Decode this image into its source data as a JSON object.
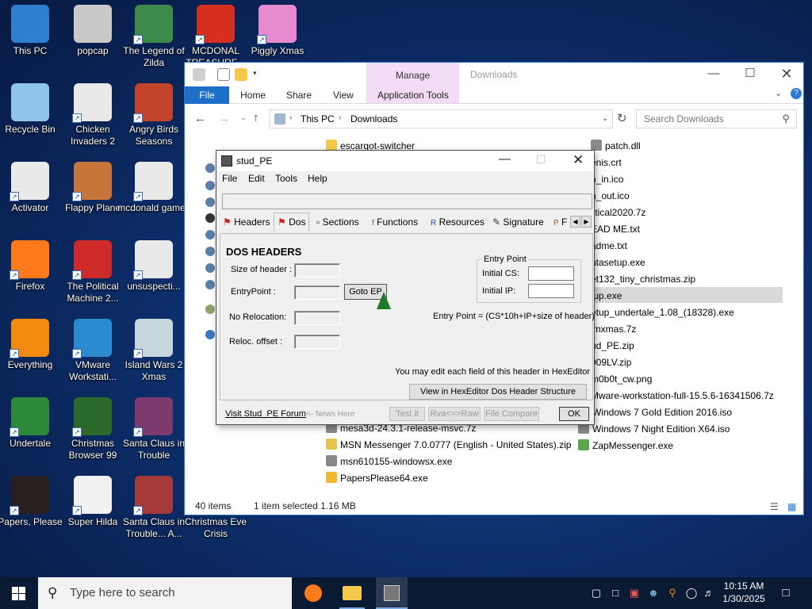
{
  "desktop": {
    "icons": [
      {
        "label": "This PC",
        "icon": "computer-icon",
        "color": "#2f7fd1"
      },
      {
        "label": "popcap",
        "icon": "popcap-icon",
        "color": "#c9c9c9"
      },
      {
        "label": "The Legend of Zilda",
        "icon": "game-icon",
        "color": "#3d8a4a"
      },
      {
        "label": "MCDONAL TREASURE...",
        "icon": "mcdonalds-icon",
        "color": "#d62f1f"
      },
      {
        "label": "Piggly Xmas",
        "icon": "pig-icon",
        "color": "#e78bd0"
      },
      {
        "label": "Recycle Bin",
        "icon": "recycle-bin-icon",
        "color": "#8fc6e8"
      },
      {
        "label": "Chicken Invaders 2",
        "icon": "chicken-icon",
        "color": "#e9e9e9"
      },
      {
        "label": "Angry Birds Seasons",
        "icon": "angry-birds-icon",
        "color": "#c4432b"
      },
      {
        "label": "Activator",
        "icon": "folder-icon",
        "color": "#e9e9e9"
      },
      {
        "label": "Flappy Plane",
        "icon": "plane-icon",
        "color": "#c6763a"
      },
      {
        "label": "mcdonald games",
        "icon": "folder-icon",
        "color": "#e9e9e9"
      },
      {
        "label": "Firefox",
        "icon": "firefox-icon",
        "color": "#ff7a1a"
      },
      {
        "label": "The Political Machine 2...",
        "icon": "political-icon",
        "color": "#cf2a2a"
      },
      {
        "label": "unsuspecti...",
        "icon": "folder-icon",
        "color": "#e9e9e9"
      },
      {
        "label": "Everything",
        "icon": "search-icon",
        "color": "#f28a10"
      },
      {
        "label": "VMware Workstati...",
        "icon": "vmware-icon",
        "color": "#2b8bd1"
      },
      {
        "label": "Island Wars 2 Xmas",
        "icon": "island-icon",
        "color": "#c7d6dd"
      },
      {
        "label": "Undertale",
        "icon": "undertale-icon",
        "color": "#2c8a3a"
      },
      {
        "label": "Christmas Browser 99",
        "icon": "christmas-tree-icon",
        "color": "#2b6a2a"
      },
      {
        "label": "Santa Claus in Trouble",
        "icon": "santa-icon",
        "color": "#7c3a6e"
      },
      {
        "label": "Papers, Please",
        "icon": "papers-please-icon",
        "color": "#2a1f1f"
      },
      {
        "label": "Super Hilda",
        "icon": "hilda-icon",
        "color": "#f1f1f1"
      },
      {
        "label": "Santa Claus in Trouble... A...",
        "icon": "santa-icon",
        "color": "#a63a3a"
      },
      {
        "label": "Christmas Eve Crisis",
        "icon": "blank-icon",
        "color": "#0d2f6c"
      }
    ]
  },
  "explorer": {
    "ribbon_context": "Manage",
    "window_title": "Downloads",
    "tabs": [
      "File",
      "Home",
      "Share",
      "View",
      "Application Tools"
    ],
    "breadcrumb": [
      "This PC",
      "Downloads"
    ],
    "search_placeholder": "Search Downloads",
    "files_left": [
      "escargot-switcher",
      "mesa3d-24.3.1-release-msvc.7z",
      "MSN Messenger 7.0.0777 (English - United States).zip",
      "msn610155-windowsx.exe",
      "PapersPlease64.exe"
    ],
    "files_right": [
      "patch.dll",
      "enis.crt",
      "n_in.ico",
      "n_out.ico",
      "litical2020.7z",
      "EAD ME.txt",
      "adme.txt",
      "ntasetup.exe",
      "et132_tiny_christmas.zip",
      "tup.exe",
      "etup_undertale_1.08_(18328).exe",
      "imxmas.7z",
      "ud_PE.zip",
      "009LV.zip",
      "m0b0t_cw.png",
      "Mware-workstation-full-15.5.6-16341506.7z",
      "Windows 7 Gold Edition 2016.iso",
      "Windows 7 Night Edition X64.iso",
      "ZapMessenger.exe"
    ],
    "status_count": "40 items",
    "status_selected": "1 item selected  1.16 MB",
    "accent": "#1e6fc8"
  },
  "studpe": {
    "title": "stud_PE",
    "menu": [
      "File",
      "Edit",
      "Tools",
      "Help"
    ],
    "tabs": [
      "Headers",
      "Dos",
      "Sections",
      "Functions",
      "Resources",
      "Signature",
      "F"
    ],
    "section_title": "DOS HEADERS",
    "labels": {
      "size_of_header": "Size of header :",
      "entry_point": "EntryPoint :",
      "no_relocation": "No Relocation:",
      "reloc_offset": "Reloc. offset :"
    },
    "goto_ep": "Goto EP",
    "group_title": "Entry Point",
    "initial_cs": "Initial CS:",
    "initial_ip": "Initial IP:",
    "formula": "Entry Point = (CS*10h+IP+size of header)",
    "hint": "You may edit each field of this header in HexEditor",
    "view_button": "View in HexEditor Dos Header Structure",
    "footer": {
      "forum_link": "Visit Stud_PE Forum",
      "news": "<- News Here",
      "test_it": "Test it",
      "rva_raw": "Rva<=>Raw",
      "file_compare": "File Compare",
      "ok": "OK"
    }
  },
  "taskbar": {
    "search_placeholder": "Type here to search",
    "time": "10:15 AM",
    "date": "1/30/2025"
  }
}
